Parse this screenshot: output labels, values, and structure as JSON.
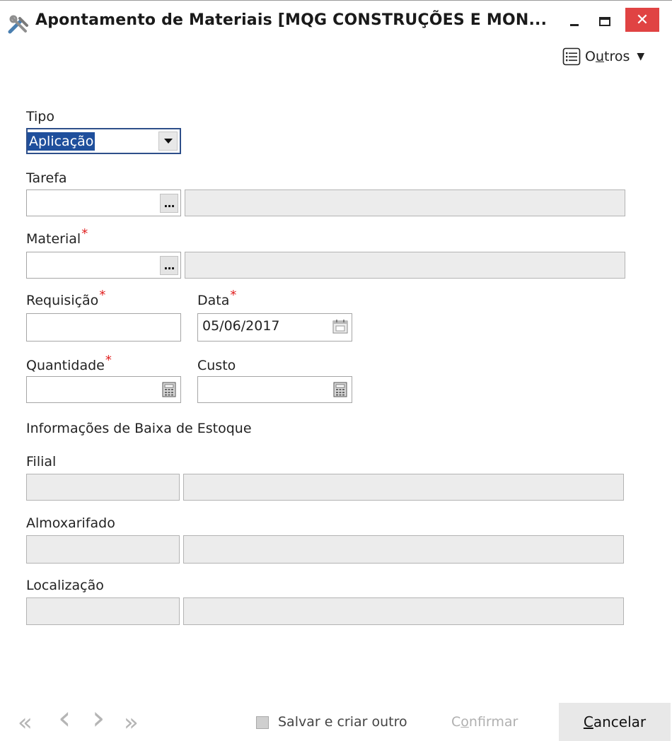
{
  "window": {
    "title": "Apontamento de Materiais [MQG CONSTRUÇÕES E MON...",
    "close_glyph": "✕"
  },
  "toolbar": {
    "outros_prefix": "O",
    "outros_underlined": "u",
    "outros_suffix": "tros",
    "outros_caret": "▼"
  },
  "form": {
    "tipo": {
      "label": "Tipo",
      "value": "Aplicação"
    },
    "tarefa": {
      "label": "Tarefa",
      "code": "",
      "description": "",
      "lookup_label": "..."
    },
    "material": {
      "label": "Material",
      "required_mark": "*",
      "code": "",
      "description": "",
      "lookup_label": "..."
    },
    "requisicao": {
      "label": "Requisição",
      "required_mark": "*",
      "value": ""
    },
    "data": {
      "label": "Data",
      "required_mark": "*",
      "value": "05/06/2017"
    },
    "quantidade": {
      "label": "Quantidade",
      "required_mark": "*",
      "value": ""
    },
    "custo": {
      "label": "Custo",
      "value": ""
    },
    "stock_section_title": "Informações de Baixa de Estoque",
    "filial": {
      "label": "Filial",
      "code": "",
      "description": ""
    },
    "almoxarifado": {
      "label": "Almoxarifado",
      "code": "",
      "description": ""
    },
    "localizacao": {
      "label": "Localização",
      "code": "",
      "description": ""
    }
  },
  "footer": {
    "nav_first": "«",
    "nav_prev": "‹",
    "nav_next": "›",
    "nav_last": "»",
    "save_and_create_label": "Salvar e criar outro",
    "save_and_create_checked": false,
    "confirm_prefix": "C",
    "confirm_underlined": "o",
    "confirm_suffix": "nfirmar",
    "cancel_underlined": "C",
    "cancel_suffix": "ancelar"
  },
  "colors": {
    "selection": "#1f4f9c",
    "close_button": "#e04343",
    "required": "#e02020",
    "disabled_field": "#ececec"
  }
}
